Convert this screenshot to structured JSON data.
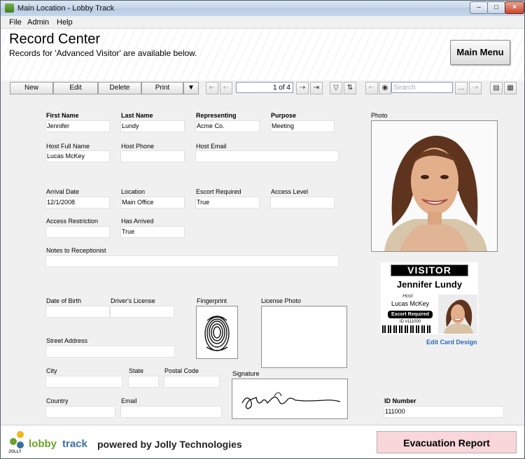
{
  "window": {
    "title": "Main Location - Lobby Track"
  },
  "menu": {
    "file": "File",
    "admin": "Admin",
    "help": "Help"
  },
  "header": {
    "title": "Record Center",
    "subtitle": "Records for 'Advanced Visitor' are available below.",
    "main_menu": "Main Menu"
  },
  "toolbar": {
    "new": "New",
    "edit": "Edit",
    "delete": "Delete",
    "print": "Print",
    "pager": "1 of 4",
    "search_placeholder": "Search"
  },
  "form": {
    "first_name": {
      "label": "First Name",
      "value": "Jennifer"
    },
    "last_name": {
      "label": "Last Name",
      "value": "Lundy"
    },
    "representing": {
      "label": "Representing",
      "value": "Acme Co."
    },
    "purpose": {
      "label": "Purpose",
      "value": "Meeting"
    },
    "host_full_name": {
      "label": "Host Full Name",
      "value": "Lucas McKey"
    },
    "host_phone": {
      "label": "Host Phone",
      "value": ""
    },
    "host_email": {
      "label": "Host Email",
      "value": ""
    },
    "arrival_date": {
      "label": "Arrival Date",
      "value": "12/1/2008"
    },
    "location": {
      "label": "Location",
      "value": "Main Office"
    },
    "escort_required": {
      "label": "Escort Required",
      "value": "True"
    },
    "access_level": {
      "label": "Access Level",
      "value": ""
    },
    "access_restriction": {
      "label": "Access Restriction",
      "value": ""
    },
    "has_arrived": {
      "label": "Has Arrived",
      "value": "True"
    },
    "notes": {
      "label": "Notes to Receptionist",
      "value": ""
    },
    "date_of_birth": {
      "label": "Date of Birth",
      "value": ""
    },
    "drivers_license": {
      "label": "Driver's License",
      "value": ""
    },
    "fingerprint": {
      "label": "Fingerprint"
    },
    "license_photo": {
      "label": "License Photo"
    },
    "street_address": {
      "label": "Street Address",
      "value": ""
    },
    "city": {
      "label": "City",
      "value": ""
    },
    "state": {
      "label": "State",
      "value": ""
    },
    "postal_code": {
      "label": "Postal Code",
      "value": ""
    },
    "signature": {
      "label": "Signature"
    },
    "country": {
      "label": "Country",
      "value": ""
    },
    "email": {
      "label": "Email",
      "value": ""
    },
    "id_number": {
      "label": "ID Number",
      "value": "111000"
    },
    "photo": {
      "label": "Photo"
    }
  },
  "badge": {
    "visitor": "VISITOR",
    "name": "Jennifer Lundy",
    "host_label": "Host",
    "host": "Lucas McKey",
    "escort": "Escort Required",
    "id": "ID #111000",
    "edit_link": "Edit Card Design"
  },
  "footer": {
    "logo_jolly": "JOLLY",
    "logo_lobby": "lobby",
    "logo_track": "track",
    "powered": "powered by Jolly Technologies",
    "evacuation": "Evacuation Report"
  }
}
